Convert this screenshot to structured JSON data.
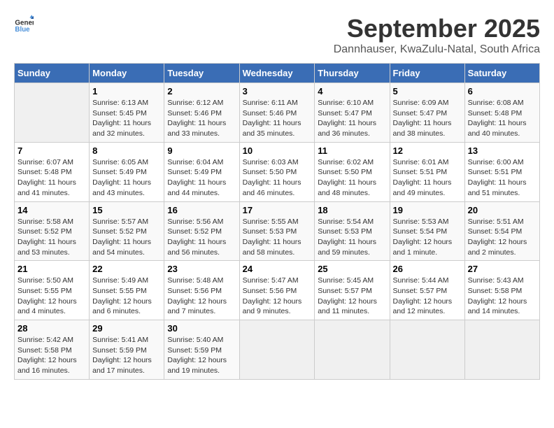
{
  "header": {
    "logo_general": "General",
    "logo_blue": "Blue",
    "month": "September 2025",
    "location": "Dannhauser, KwaZulu-Natal, South Africa"
  },
  "days_of_week": [
    "Sunday",
    "Monday",
    "Tuesday",
    "Wednesday",
    "Thursday",
    "Friday",
    "Saturday"
  ],
  "weeks": [
    [
      {
        "day": "",
        "info": ""
      },
      {
        "day": "1",
        "info": "Sunrise: 6:13 AM\nSunset: 5:45 PM\nDaylight: 11 hours\nand 32 minutes."
      },
      {
        "day": "2",
        "info": "Sunrise: 6:12 AM\nSunset: 5:46 PM\nDaylight: 11 hours\nand 33 minutes."
      },
      {
        "day": "3",
        "info": "Sunrise: 6:11 AM\nSunset: 5:46 PM\nDaylight: 11 hours\nand 35 minutes."
      },
      {
        "day": "4",
        "info": "Sunrise: 6:10 AM\nSunset: 5:47 PM\nDaylight: 11 hours\nand 36 minutes."
      },
      {
        "day": "5",
        "info": "Sunrise: 6:09 AM\nSunset: 5:47 PM\nDaylight: 11 hours\nand 38 minutes."
      },
      {
        "day": "6",
        "info": "Sunrise: 6:08 AM\nSunset: 5:48 PM\nDaylight: 11 hours\nand 40 minutes."
      }
    ],
    [
      {
        "day": "7",
        "info": "Sunrise: 6:07 AM\nSunset: 5:48 PM\nDaylight: 11 hours\nand 41 minutes."
      },
      {
        "day": "8",
        "info": "Sunrise: 6:05 AM\nSunset: 5:49 PM\nDaylight: 11 hours\nand 43 minutes."
      },
      {
        "day": "9",
        "info": "Sunrise: 6:04 AM\nSunset: 5:49 PM\nDaylight: 11 hours\nand 44 minutes."
      },
      {
        "day": "10",
        "info": "Sunrise: 6:03 AM\nSunset: 5:50 PM\nDaylight: 11 hours\nand 46 minutes."
      },
      {
        "day": "11",
        "info": "Sunrise: 6:02 AM\nSunset: 5:50 PM\nDaylight: 11 hours\nand 48 minutes."
      },
      {
        "day": "12",
        "info": "Sunrise: 6:01 AM\nSunset: 5:51 PM\nDaylight: 11 hours\nand 49 minutes."
      },
      {
        "day": "13",
        "info": "Sunrise: 6:00 AM\nSunset: 5:51 PM\nDaylight: 11 hours\nand 51 minutes."
      }
    ],
    [
      {
        "day": "14",
        "info": "Sunrise: 5:58 AM\nSunset: 5:52 PM\nDaylight: 11 hours\nand 53 minutes."
      },
      {
        "day": "15",
        "info": "Sunrise: 5:57 AM\nSunset: 5:52 PM\nDaylight: 11 hours\nand 54 minutes."
      },
      {
        "day": "16",
        "info": "Sunrise: 5:56 AM\nSunset: 5:52 PM\nDaylight: 11 hours\nand 56 minutes."
      },
      {
        "day": "17",
        "info": "Sunrise: 5:55 AM\nSunset: 5:53 PM\nDaylight: 11 hours\nand 58 minutes."
      },
      {
        "day": "18",
        "info": "Sunrise: 5:54 AM\nSunset: 5:53 PM\nDaylight: 11 hours\nand 59 minutes."
      },
      {
        "day": "19",
        "info": "Sunrise: 5:53 AM\nSunset: 5:54 PM\nDaylight: 12 hours\nand 1 minute."
      },
      {
        "day": "20",
        "info": "Sunrise: 5:51 AM\nSunset: 5:54 PM\nDaylight: 12 hours\nand 2 minutes."
      }
    ],
    [
      {
        "day": "21",
        "info": "Sunrise: 5:50 AM\nSunset: 5:55 PM\nDaylight: 12 hours\nand 4 minutes."
      },
      {
        "day": "22",
        "info": "Sunrise: 5:49 AM\nSunset: 5:55 PM\nDaylight: 12 hours\nand 6 minutes."
      },
      {
        "day": "23",
        "info": "Sunrise: 5:48 AM\nSunset: 5:56 PM\nDaylight: 12 hours\nand 7 minutes."
      },
      {
        "day": "24",
        "info": "Sunrise: 5:47 AM\nSunset: 5:56 PM\nDaylight: 12 hours\nand 9 minutes."
      },
      {
        "day": "25",
        "info": "Sunrise: 5:45 AM\nSunset: 5:57 PM\nDaylight: 12 hours\nand 11 minutes."
      },
      {
        "day": "26",
        "info": "Sunrise: 5:44 AM\nSunset: 5:57 PM\nDaylight: 12 hours\nand 12 minutes."
      },
      {
        "day": "27",
        "info": "Sunrise: 5:43 AM\nSunset: 5:58 PM\nDaylight: 12 hours\nand 14 minutes."
      }
    ],
    [
      {
        "day": "28",
        "info": "Sunrise: 5:42 AM\nSunset: 5:58 PM\nDaylight: 12 hours\nand 16 minutes."
      },
      {
        "day": "29",
        "info": "Sunrise: 5:41 AM\nSunset: 5:59 PM\nDaylight: 12 hours\nand 17 minutes."
      },
      {
        "day": "30",
        "info": "Sunrise: 5:40 AM\nSunset: 5:59 PM\nDaylight: 12 hours\nand 19 minutes."
      },
      {
        "day": "",
        "info": ""
      },
      {
        "day": "",
        "info": ""
      },
      {
        "day": "",
        "info": ""
      },
      {
        "day": "",
        "info": ""
      }
    ]
  ]
}
